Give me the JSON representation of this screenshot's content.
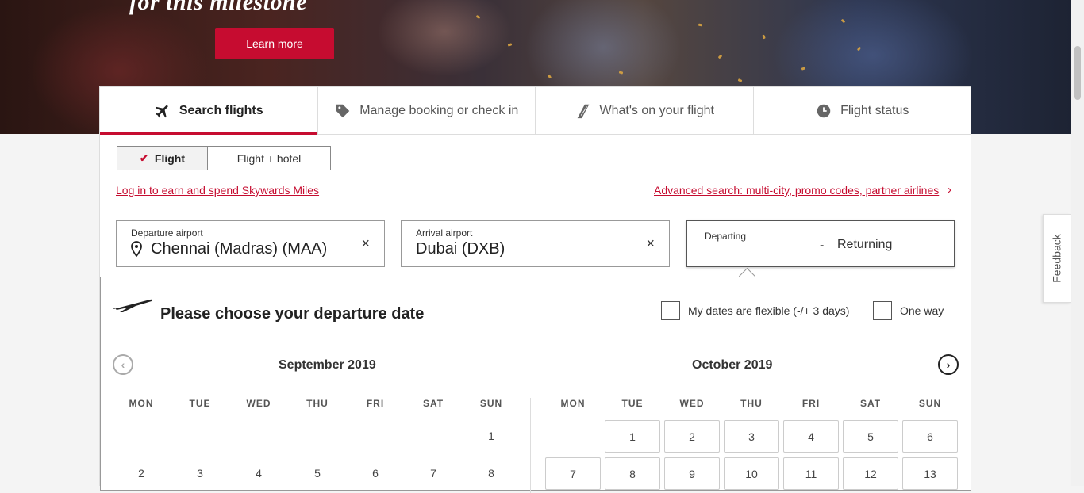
{
  "hero": {
    "title": "for this milestone",
    "learn_more": "Learn more"
  },
  "tabs": [
    {
      "label": "Search flights",
      "icon": "plane-icon",
      "active": true
    },
    {
      "label": "Manage booking or check in",
      "icon": "tag-icon",
      "active": false
    },
    {
      "label": "What's on your flight",
      "icon": "seat-icon",
      "active": false
    },
    {
      "label": "Flight status",
      "icon": "clock-icon",
      "active": false
    }
  ],
  "trip_type": {
    "options": [
      "Flight",
      "Flight + hotel"
    ],
    "selected": "Flight"
  },
  "links": {
    "skywards": "Log in to earn and spend Skywards Miles",
    "advanced": "Advanced search: multi-city, promo codes, partner airlines"
  },
  "departure": {
    "label": "Departure airport",
    "value": "Chennai (Madras) (MAA)"
  },
  "arrival": {
    "label": "Arrival airport",
    "value": "Dubai (DXB)"
  },
  "dates": {
    "departing": "Departing",
    "separator": "-",
    "returning": "Returning"
  },
  "calendar": {
    "title": "Please choose your departure date",
    "flexible_label": "My dates are flexible (-/+ 3 days)",
    "one_way_label": "One way",
    "weekdays": [
      "MON",
      "TUE",
      "WED",
      "THU",
      "FRI",
      "SAT",
      "SUN"
    ],
    "left_month": {
      "name": "September 2019",
      "rows": [
        [
          "",
          "",
          "",
          "",
          "",
          "",
          "1"
        ],
        [
          "2",
          "3",
          "4",
          "5",
          "6",
          "7",
          "8"
        ]
      ]
    },
    "right_month": {
      "name": "October 2019",
      "rows": [
        [
          "",
          "1",
          "2",
          "3",
          "4",
          "5",
          "6"
        ],
        [
          "7",
          "8",
          "9",
          "10",
          "11",
          "12",
          "13"
        ]
      ]
    }
  },
  "feedback": "Feedback",
  "colors": {
    "accent": "#c60c30"
  }
}
